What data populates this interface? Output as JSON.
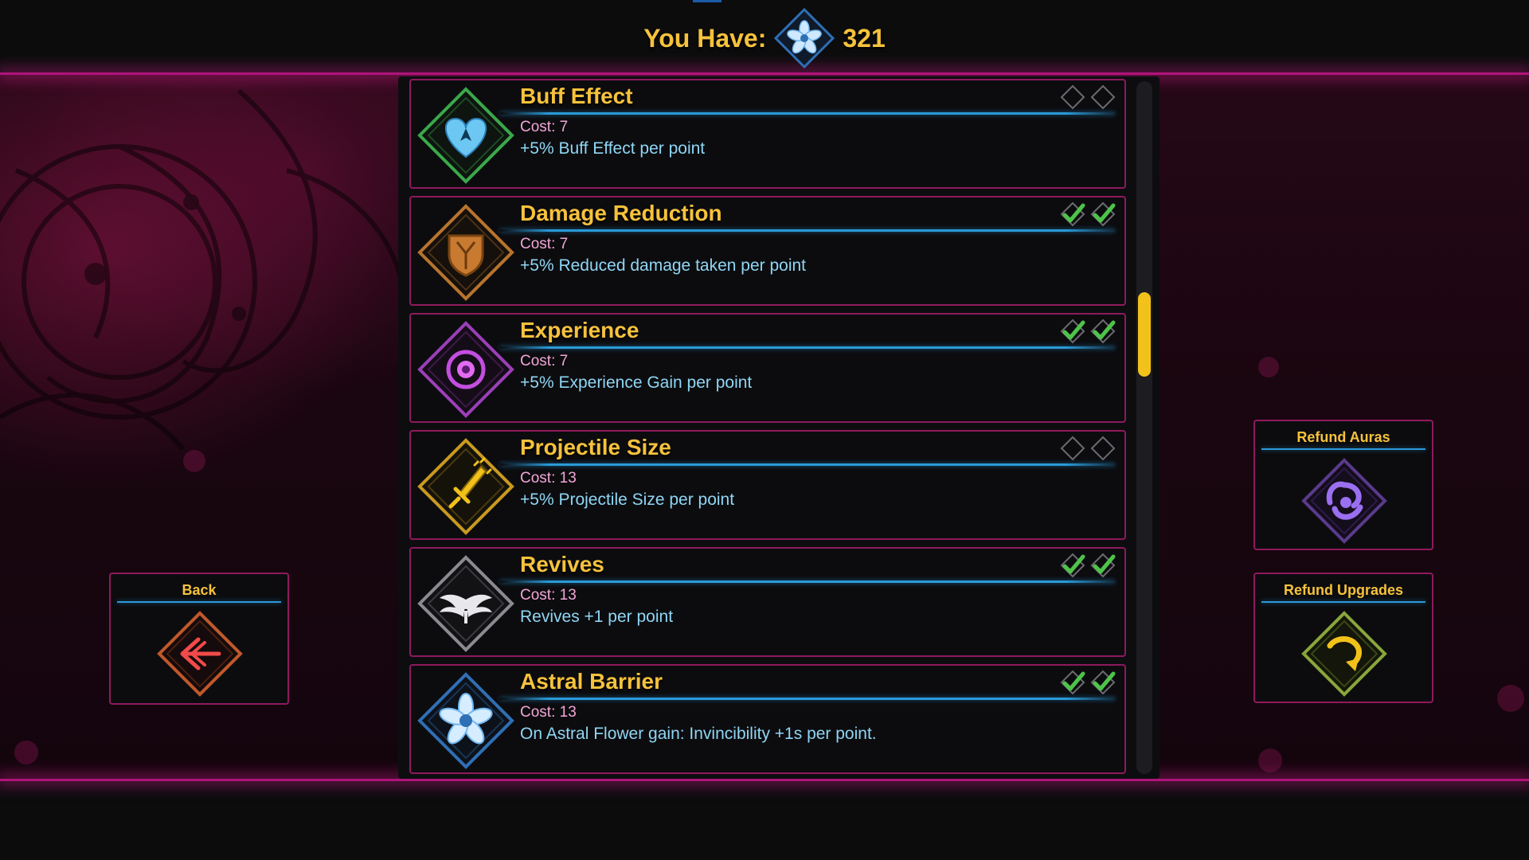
{
  "header": {
    "label": "You Have:",
    "currency_count": "321",
    "currency_icon": "astral-flower-icon"
  },
  "upgrades": [
    {
      "name": "Buff Effect",
      "cost": "Cost: 7",
      "description": "+5% Buff Effect per point",
      "icon": "heart-spade-icon",
      "frame_color": "#3aa84a",
      "level": 0,
      "max_level": 2
    },
    {
      "name": "Damage Reduction",
      "cost": "Cost: 7",
      "description": "+5% Reduced damage taken per point",
      "icon": "shield-icon",
      "frame_color": "#b8742c",
      "level": 2,
      "max_level": 2
    },
    {
      "name": "Experience",
      "cost": "Cost: 7",
      "description": "+5% Experience Gain per point",
      "icon": "experience-orb-icon",
      "frame_color": "#9b3fb8",
      "level": 2,
      "max_level": 2
    },
    {
      "name": "Projectile Size",
      "cost": "Cost: 13",
      "description": "+5% Projectile Size per point",
      "icon": "sword-icon",
      "frame_color": "#c99a20",
      "level": 0,
      "max_level": 2
    },
    {
      "name": "Revives",
      "cost": "Cost: 13",
      "description": "Revives +1 per point",
      "icon": "wings-icon",
      "frame_color": "#8a8a90",
      "level": 2,
      "max_level": 2
    },
    {
      "name": "Astral Barrier",
      "cost": "Cost: 13",
      "description": "On Astral Flower gain: Invincibility +1s per point.",
      "icon": "astral-flower-icon",
      "frame_color": "#2f6fb4",
      "level": 2,
      "max_level": 2
    }
  ],
  "scrollbar": {
    "position": 0.3
  },
  "buttons": {
    "back": {
      "label": "Back",
      "icon": "back-arrow-icon"
    },
    "refund_auras": {
      "label": "Refund Auras",
      "icon": "swirl-icon"
    },
    "refund_upgrades": {
      "label": "Refund Upgrades",
      "icon": "curved-arrow-icon"
    }
  },
  "colors": {
    "accent_gold": "#f6c23c",
    "accent_magenta": "#b0147a",
    "accent_blue": "#2a9ad8",
    "check_green": "#4ec34a"
  }
}
